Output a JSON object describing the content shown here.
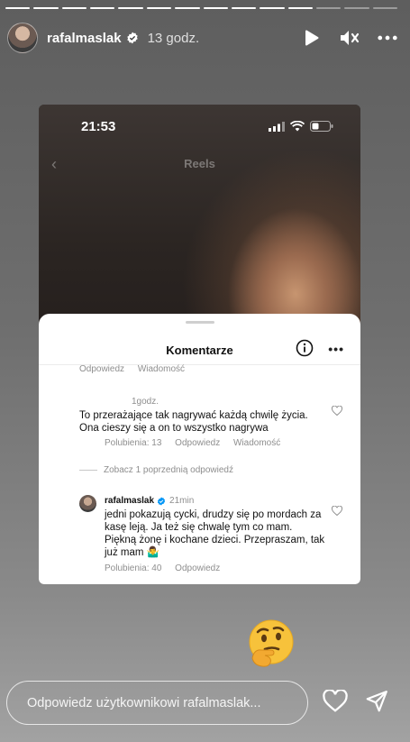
{
  "story": {
    "segments_total": 14,
    "segments_done": 11,
    "username": "rafalmaslak",
    "posted_ago": "13 godz."
  },
  "controls": {
    "play_icon": "play-icon",
    "mute_icon": "mute-icon",
    "more_icon": "more-icon"
  },
  "screenshot": {
    "phone_time": "21:53",
    "reels_title": "Reels",
    "comments": {
      "title": "Komentarze",
      "top_actions": [
        "Odpowiedz",
        "Wiadomość"
      ],
      "comment1": {
        "time": "1godz.",
        "text": "To przerażające tak nagrywać każdą chwilę życia. Ona cieszy się a on to wszystko nagrywa",
        "likes": "Polubienia: 13",
        "reply": "Odpowiedz",
        "message": "Wiadomość"
      },
      "see_more": "Zobacz 1 poprzednią odpowiedź",
      "comment2": {
        "username": "rafalmaslak",
        "time": "21min",
        "text": "jedni pokazują cycki, drudzy się po mordach za kasę leją. Ja też się chwalę tym co mam. Piękną żonę i kochane dzieci. Przepraszam, tak już mam 🤷‍♂️",
        "likes": "Polubienia: 40",
        "reply": "Odpowiedz"
      }
    }
  },
  "sticker": {
    "emoji": "🤔"
  },
  "reply_bar": {
    "placeholder": "Odpowiedz użytkownikowi rafalmaslak..."
  },
  "colors": {
    "verified_blue": "#0095f6",
    "muted_text": "#8e8e8e"
  }
}
